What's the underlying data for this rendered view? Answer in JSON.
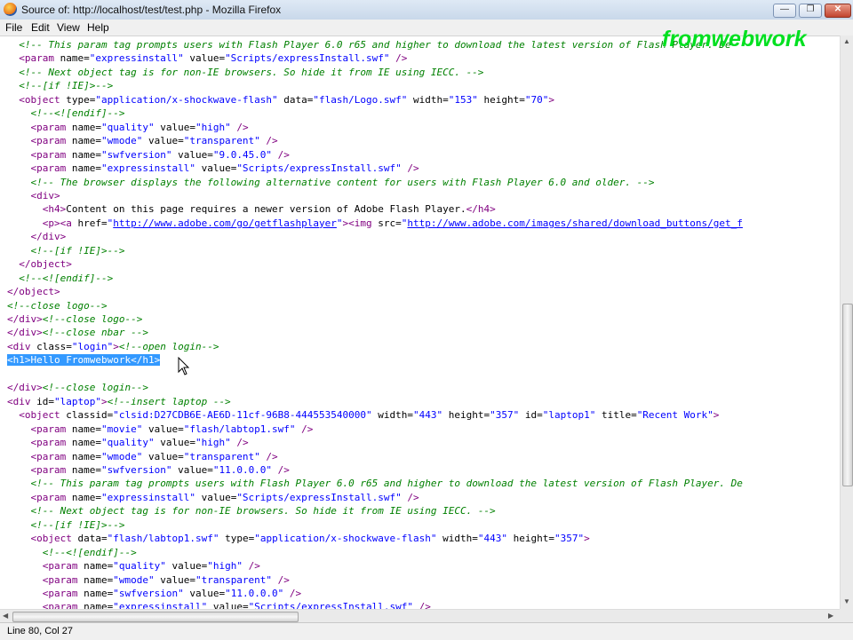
{
  "window": {
    "title": "Source of: http://localhost/test/test.php - Mozilla Firefox"
  },
  "menu": [
    "File",
    "Edit",
    "View",
    "Help"
  ],
  "watermark": "fromwebwork",
  "status": "Line 80, Col 27",
  "source_lines": [
    [
      {
        "t": "  "
      },
      {
        "c": "c",
        "t": "<!-- This param tag prompts users with Flash Player 6.0 r65 and higher to download the latest version of Flash Player. De"
      }
    ],
    [
      {
        "t": "  "
      },
      {
        "c": "t",
        "t": "<param "
      },
      {
        "c": "a",
        "t": "name="
      },
      {
        "c": "v",
        "t": "\"expressinstall\""
      },
      {
        "c": "a",
        "t": " value="
      },
      {
        "c": "v",
        "t": "\"Scripts/expressInstall.swf\""
      },
      {
        "c": "t",
        "t": " />"
      }
    ],
    [
      {
        "t": "  "
      },
      {
        "c": "c",
        "t": "<!-- Next object tag is for non-IE browsers. So hide it from IE using IECC. -->"
      }
    ],
    [
      {
        "t": "  "
      },
      {
        "c": "c",
        "t": "<!--[if !IE]>-->"
      }
    ],
    [
      {
        "t": "  "
      },
      {
        "c": "t",
        "t": "<object "
      },
      {
        "c": "a",
        "t": "type="
      },
      {
        "c": "v",
        "t": "\"application/x-shockwave-flash\""
      },
      {
        "c": "a",
        "t": " data="
      },
      {
        "c": "v",
        "t": "\"flash/Logo.swf\""
      },
      {
        "c": "a",
        "t": " width="
      },
      {
        "c": "v",
        "t": "\"153\""
      },
      {
        "c": "a",
        "t": " height="
      },
      {
        "c": "v",
        "t": "\"70\""
      },
      {
        "c": "t",
        "t": ">"
      }
    ],
    [
      {
        "t": "    "
      },
      {
        "c": "c",
        "t": "<!--<![endif]-->"
      }
    ],
    [
      {
        "t": "    "
      },
      {
        "c": "t",
        "t": "<param "
      },
      {
        "c": "a",
        "t": "name="
      },
      {
        "c": "v",
        "t": "\"quality\""
      },
      {
        "c": "a",
        "t": " value="
      },
      {
        "c": "v",
        "t": "\"high\""
      },
      {
        "c": "t",
        "t": " />"
      }
    ],
    [
      {
        "t": "    "
      },
      {
        "c": "t",
        "t": "<param "
      },
      {
        "c": "a",
        "t": "name="
      },
      {
        "c": "v",
        "t": "\"wmode\""
      },
      {
        "c": "a",
        "t": " value="
      },
      {
        "c": "v",
        "t": "\"transparent\""
      },
      {
        "c": "t",
        "t": " />"
      }
    ],
    [
      {
        "t": "    "
      },
      {
        "c": "t",
        "t": "<param "
      },
      {
        "c": "a",
        "t": "name="
      },
      {
        "c": "v",
        "t": "\"swfversion\""
      },
      {
        "c": "a",
        "t": " value="
      },
      {
        "c": "v",
        "t": "\"9.0.45.0\""
      },
      {
        "c": "t",
        "t": " />"
      }
    ],
    [
      {
        "t": "    "
      },
      {
        "c": "t",
        "t": "<param "
      },
      {
        "c": "a",
        "t": "name="
      },
      {
        "c": "v",
        "t": "\"expressinstall\""
      },
      {
        "c": "a",
        "t": " value="
      },
      {
        "c": "v",
        "t": "\"Scripts/expressInstall.swf\""
      },
      {
        "c": "t",
        "t": " />"
      }
    ],
    [
      {
        "t": "    "
      },
      {
        "c": "c",
        "t": "<!-- The browser displays the following alternative content for users with Flash Player 6.0 and older. -->"
      }
    ],
    [
      {
        "t": "    "
      },
      {
        "c": "t",
        "t": "<div>"
      }
    ],
    [
      {
        "t": "      "
      },
      {
        "c": "t",
        "t": "<h4>"
      },
      {
        "c": "a",
        "t": "Content on this page requires a newer version of Adobe Flash Player."
      },
      {
        "c": "t",
        "t": "</h4>"
      }
    ],
    [
      {
        "t": "      "
      },
      {
        "c": "t",
        "t": "<p><a "
      },
      {
        "c": "a",
        "t": "href="
      },
      {
        "c": "v",
        "t": "\""
      },
      {
        "c": "u",
        "t": "http://www.adobe.com/go/getflashplayer"
      },
      {
        "c": "v",
        "t": "\""
      },
      {
        "c": "t",
        "t": "><img "
      },
      {
        "c": "a",
        "t": "src="
      },
      {
        "c": "v",
        "t": "\""
      },
      {
        "c": "u",
        "t": "http://www.adobe.com/images/shared/download_buttons/get_f"
      }
    ],
    [
      {
        "t": "    "
      },
      {
        "c": "t",
        "t": "</div>"
      }
    ],
    [
      {
        "t": "    "
      },
      {
        "c": "c",
        "t": "<!--[if !IE]>-->"
      }
    ],
    [
      {
        "t": "  "
      },
      {
        "c": "t",
        "t": "</object>"
      }
    ],
    [
      {
        "t": "  "
      },
      {
        "c": "c",
        "t": "<!--<![endif]-->"
      }
    ],
    [
      {
        "c": "t",
        "t": "</object>"
      }
    ],
    [
      {
        "c": "c",
        "t": "<!--close logo-->"
      }
    ],
    [
      {
        "c": "t",
        "t": "</div>"
      },
      {
        "c": "c",
        "t": "<!--close logo-->"
      }
    ],
    [
      {
        "c": "t",
        "t": "</div>"
      },
      {
        "c": "c",
        "t": "<!--close nbar -->"
      }
    ],
    [
      {
        "c": "t",
        "t": "<div "
      },
      {
        "c": "a",
        "t": "class="
      },
      {
        "c": "v",
        "t": "\"login\""
      },
      {
        "c": "t",
        "t": ">"
      },
      {
        "c": "c",
        "t": "<!--open login-->"
      }
    ],
    [
      {
        "c": "sel",
        "t": "<h1>Hello Fromwebwork</h1>"
      }
    ],
    [
      {
        "t": ""
      }
    ],
    [
      {
        "c": "t",
        "t": "</div>"
      },
      {
        "c": "c",
        "t": "<!--close login-->"
      }
    ],
    [
      {
        "c": "t",
        "t": "<div "
      },
      {
        "c": "a",
        "t": "id="
      },
      {
        "c": "v",
        "t": "\"laptop\""
      },
      {
        "c": "t",
        "t": ">"
      },
      {
        "c": "c",
        "t": "<!--insert laptop -->"
      }
    ],
    [
      {
        "t": "  "
      },
      {
        "c": "t",
        "t": "<object "
      },
      {
        "c": "a",
        "t": "classid="
      },
      {
        "c": "v",
        "t": "\"clsid:D27CDB6E-AE6D-11cf-96B8-444553540000\""
      },
      {
        "c": "a",
        "t": " width="
      },
      {
        "c": "v",
        "t": "\"443\""
      },
      {
        "c": "a",
        "t": " height="
      },
      {
        "c": "v",
        "t": "\"357\""
      },
      {
        "c": "a",
        "t": " id="
      },
      {
        "c": "v",
        "t": "\"laptop1\""
      },
      {
        "c": "a",
        "t": " title="
      },
      {
        "c": "v",
        "t": "\"Recent Work\""
      },
      {
        "c": "t",
        "t": ">"
      }
    ],
    [
      {
        "t": "    "
      },
      {
        "c": "t",
        "t": "<param "
      },
      {
        "c": "a",
        "t": "name="
      },
      {
        "c": "v",
        "t": "\"movie\""
      },
      {
        "c": "a",
        "t": " value="
      },
      {
        "c": "v",
        "t": "\"flash/labtop1.swf\""
      },
      {
        "c": "t",
        "t": " />"
      }
    ],
    [
      {
        "t": "    "
      },
      {
        "c": "t",
        "t": "<param "
      },
      {
        "c": "a",
        "t": "name="
      },
      {
        "c": "v",
        "t": "\"quality\""
      },
      {
        "c": "a",
        "t": " value="
      },
      {
        "c": "v",
        "t": "\"high\""
      },
      {
        "c": "t",
        "t": " />"
      }
    ],
    [
      {
        "t": "    "
      },
      {
        "c": "t",
        "t": "<param "
      },
      {
        "c": "a",
        "t": "name="
      },
      {
        "c": "v",
        "t": "\"wmode\""
      },
      {
        "c": "a",
        "t": " value="
      },
      {
        "c": "v",
        "t": "\"transparent\""
      },
      {
        "c": "t",
        "t": " />"
      }
    ],
    [
      {
        "t": "    "
      },
      {
        "c": "t",
        "t": "<param "
      },
      {
        "c": "a",
        "t": "name="
      },
      {
        "c": "v",
        "t": "\"swfversion\""
      },
      {
        "c": "a",
        "t": " value="
      },
      {
        "c": "v",
        "t": "\"11.0.0.0\""
      },
      {
        "c": "t",
        "t": " />"
      }
    ],
    [
      {
        "t": "    "
      },
      {
        "c": "c",
        "t": "<!-- This param tag prompts users with Flash Player 6.0 r65 and higher to download the latest version of Flash Player. De"
      }
    ],
    [
      {
        "t": "    "
      },
      {
        "c": "t",
        "t": "<param "
      },
      {
        "c": "a",
        "t": "name="
      },
      {
        "c": "v",
        "t": "\"expressinstall\""
      },
      {
        "c": "a",
        "t": " value="
      },
      {
        "c": "v",
        "t": "\"Scripts/expressInstall.swf\""
      },
      {
        "c": "t",
        "t": " />"
      }
    ],
    [
      {
        "t": "    "
      },
      {
        "c": "c",
        "t": "<!-- Next object tag is for non-IE browsers. So hide it from IE using IECC. -->"
      }
    ],
    [
      {
        "t": "    "
      },
      {
        "c": "c",
        "t": "<!--[if !IE]>-->"
      }
    ],
    [
      {
        "t": "    "
      },
      {
        "c": "t",
        "t": "<object "
      },
      {
        "c": "a",
        "t": "data="
      },
      {
        "c": "v",
        "t": "\"flash/labtop1.swf\""
      },
      {
        "c": "a",
        "t": " type="
      },
      {
        "c": "v",
        "t": "\"application/x-shockwave-flash\""
      },
      {
        "c": "a",
        "t": " width="
      },
      {
        "c": "v",
        "t": "\"443\""
      },
      {
        "c": "a",
        "t": " height="
      },
      {
        "c": "v",
        "t": "\"357\""
      },
      {
        "c": "t",
        "t": ">"
      }
    ],
    [
      {
        "t": "      "
      },
      {
        "c": "c",
        "t": "<!--<![endif]-->"
      }
    ],
    [
      {
        "t": "      "
      },
      {
        "c": "t",
        "t": "<param "
      },
      {
        "c": "a",
        "t": "name="
      },
      {
        "c": "v",
        "t": "\"quality\""
      },
      {
        "c": "a",
        "t": " value="
      },
      {
        "c": "v",
        "t": "\"high\""
      },
      {
        "c": "t",
        "t": " />"
      }
    ],
    [
      {
        "t": "      "
      },
      {
        "c": "t",
        "t": "<param "
      },
      {
        "c": "a",
        "t": "name="
      },
      {
        "c": "v",
        "t": "\"wmode\""
      },
      {
        "c": "a",
        "t": " value="
      },
      {
        "c": "v",
        "t": "\"transparent\""
      },
      {
        "c": "t",
        "t": " />"
      }
    ],
    [
      {
        "t": "      "
      },
      {
        "c": "t",
        "t": "<param "
      },
      {
        "c": "a",
        "t": "name="
      },
      {
        "c": "v",
        "t": "\"swfversion\""
      },
      {
        "c": "a",
        "t": " value="
      },
      {
        "c": "v",
        "t": "\"11.0.0.0\""
      },
      {
        "c": "t",
        "t": " />"
      }
    ],
    [
      {
        "t": "      "
      },
      {
        "c": "t",
        "t": "<param "
      },
      {
        "c": "a",
        "t": "name="
      },
      {
        "c": "v",
        "t": "\"expressinstall\""
      },
      {
        "c": "a",
        "t": " value="
      },
      {
        "c": "v",
        "t": "\"Scripts/expressInstall.swf\""
      },
      {
        "c": "t",
        "t": " />"
      }
    ]
  ]
}
